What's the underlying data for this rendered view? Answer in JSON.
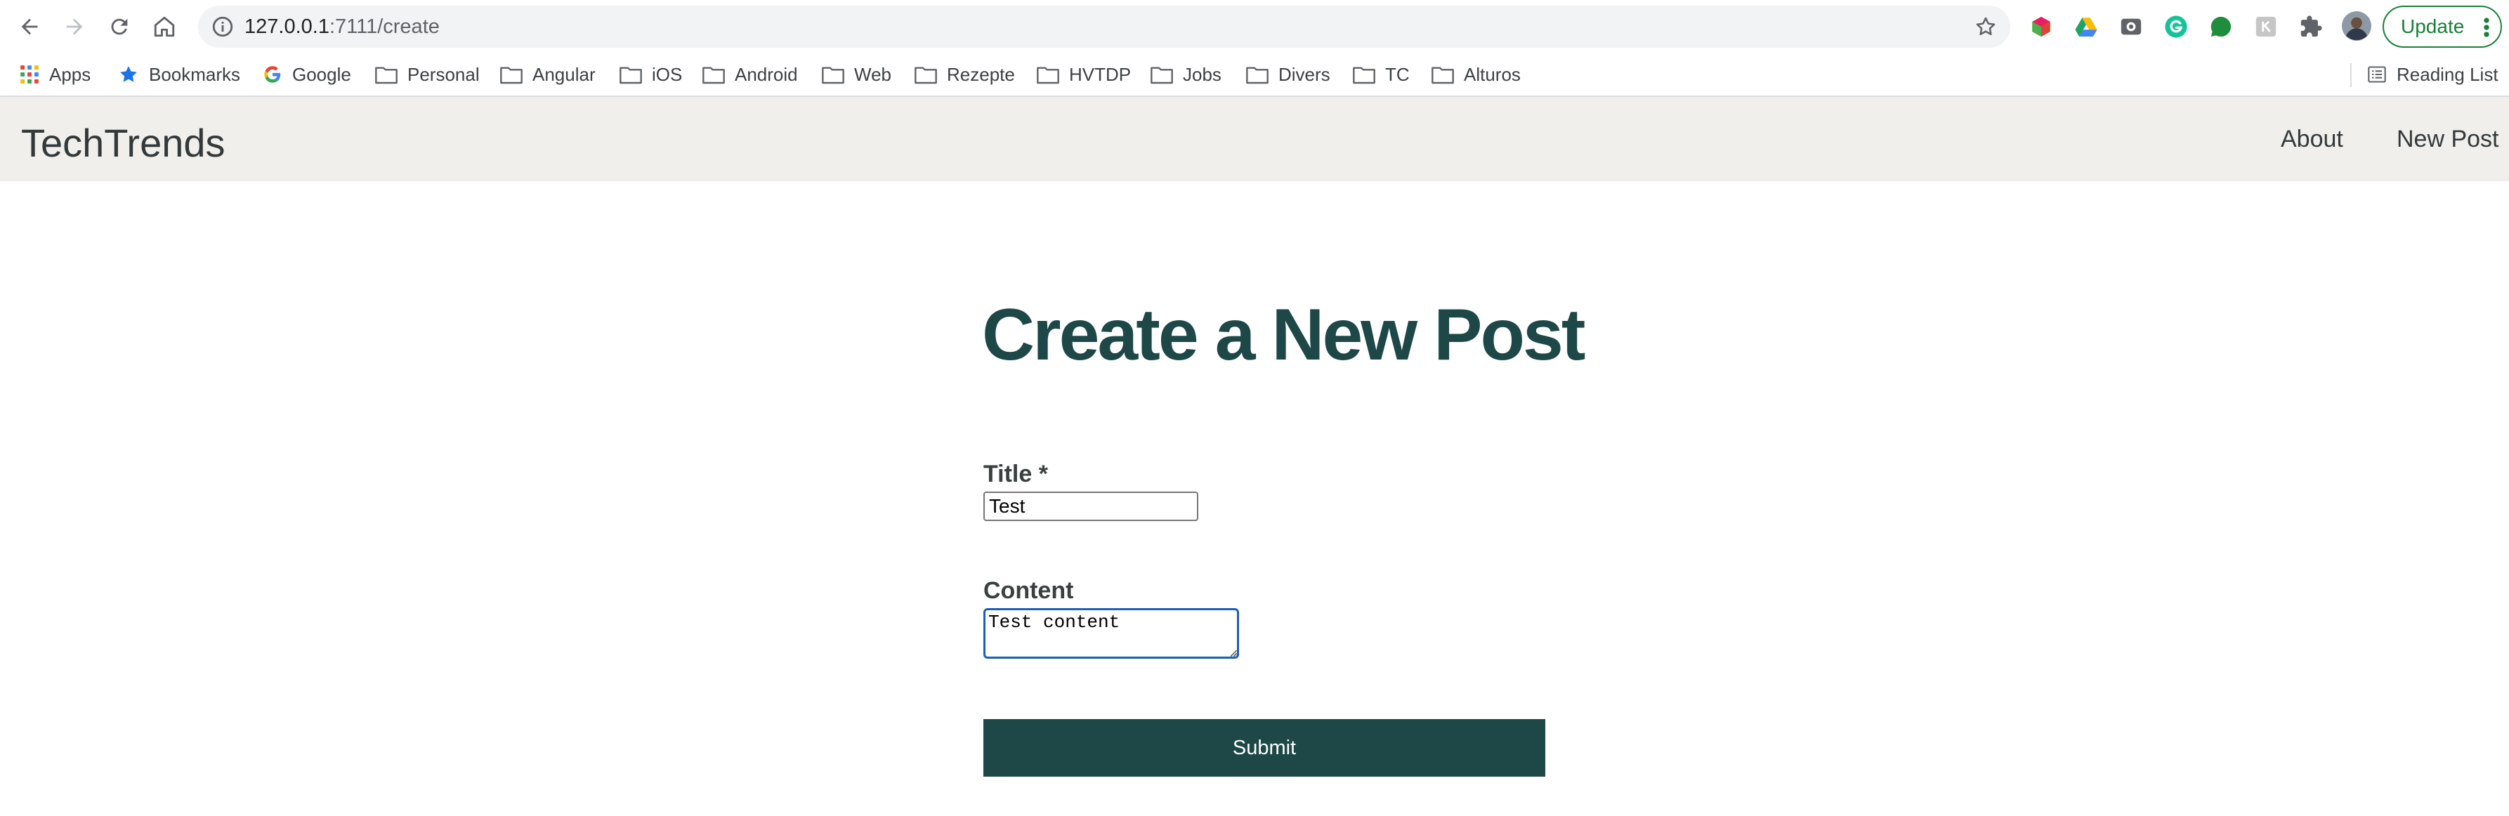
{
  "browser": {
    "url_host": "127.0.0.1",
    "url_path": ":7111/create",
    "update_label": "Update",
    "bookmarks": [
      {
        "label": "Apps",
        "icon": "apps-grid-icon"
      },
      {
        "label": "Bookmarks",
        "icon": "star-icon"
      },
      {
        "label": "Google",
        "icon": "google-icon"
      },
      {
        "label": "Personal",
        "icon": "folder-icon"
      },
      {
        "label": "Angular",
        "icon": "folder-icon"
      },
      {
        "label": "iOS",
        "icon": "folder-icon"
      },
      {
        "label": "Android",
        "icon": "folder-icon"
      },
      {
        "label": "Web",
        "icon": "folder-icon"
      },
      {
        "label": "Rezepte",
        "icon": "folder-icon"
      },
      {
        "label": "HVTDP",
        "icon": "folder-icon"
      },
      {
        "label": "Jobs",
        "icon": "folder-icon"
      },
      {
        "label": "Divers",
        "icon": "folder-icon"
      },
      {
        "label": "TC",
        "icon": "folder-icon"
      },
      {
        "label": "Alturos",
        "icon": "folder-icon"
      }
    ],
    "reading_list_label": "Reading List",
    "accent_color": "#188038"
  },
  "site": {
    "brand": "TechTrends",
    "nav": {
      "about": "About",
      "new_post": "New Post"
    },
    "header_bg": "#f0efec"
  },
  "form": {
    "heading": "Create a New Post",
    "title_label": "Title *",
    "title_value": "Test",
    "content_label": "Content",
    "content_value": "Test content",
    "submit_label": "Submit",
    "primary_color": "#1e4848"
  }
}
